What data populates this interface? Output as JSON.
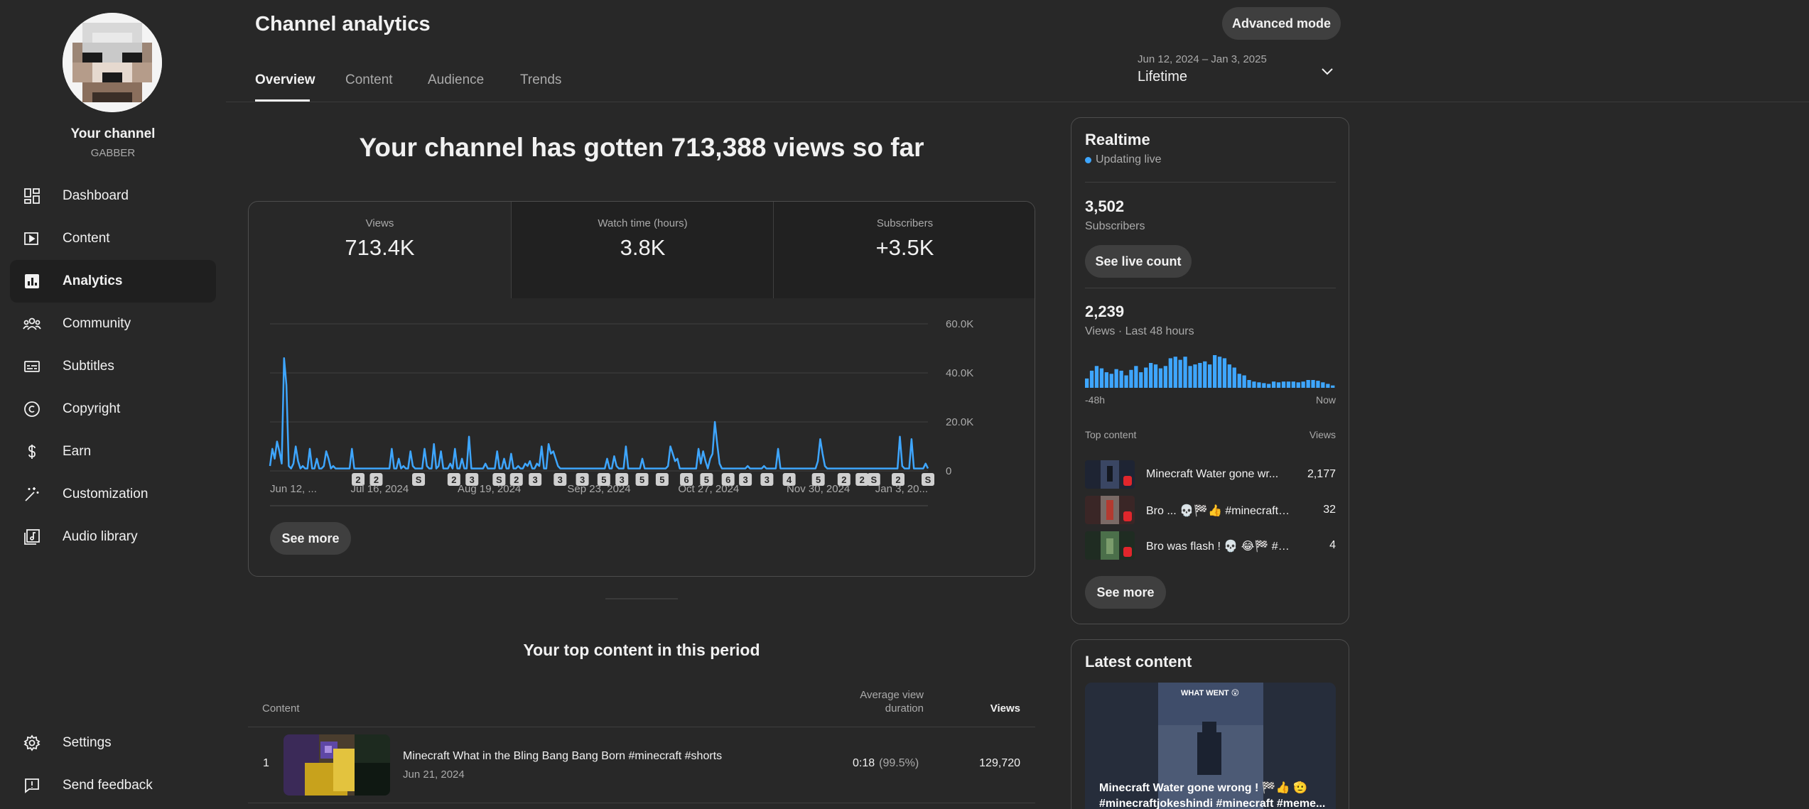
{
  "sidebar": {
    "channel_name": "Your channel",
    "channel_handle": "GABBER",
    "items": [
      {
        "label": "Dashboard",
        "icon": "dashboard-icon"
      },
      {
        "label": "Content",
        "icon": "content-icon"
      },
      {
        "label": "Analytics",
        "icon": "analytics-icon",
        "active": true
      },
      {
        "label": "Community",
        "icon": "community-icon"
      },
      {
        "label": "Subtitles",
        "icon": "subtitles-icon"
      },
      {
        "label": "Copyright",
        "icon": "copyright-icon"
      },
      {
        "label": "Earn",
        "icon": "earn-icon"
      },
      {
        "label": "Customization",
        "icon": "customization-icon"
      },
      {
        "label": "Audio library",
        "icon": "audio-library-icon"
      }
    ],
    "bottom_items": [
      {
        "label": "Settings",
        "icon": "gear-icon"
      },
      {
        "label": "Send feedback",
        "icon": "feedback-icon"
      }
    ]
  },
  "header": {
    "title": "Channel analytics",
    "advanced_mode": "Advanced mode",
    "tabs": [
      "Overview",
      "Content",
      "Audience",
      "Trends"
    ],
    "date_range": "Jun 12, 2024 – Jan 3, 2025",
    "date_selection": "Lifetime"
  },
  "headline": "Your channel has gotten 713,388 views so far",
  "metrics": [
    {
      "label": "Views",
      "value": "713.4K"
    },
    {
      "label": "Watch time (hours)",
      "value": "3.8K"
    },
    {
      "label": "Subscribers",
      "value": "+3.5K"
    }
  ],
  "see_more": "See more",
  "chart_data": {
    "type": "line",
    "x_tick_labels": [
      "Jun 12, ...",
      "Jul 16, 2024",
      "Aug 19, 2024",
      "Sep 23, 2024",
      "Oct 27, 2024",
      "Nov 30, 2024",
      "Jan 3, 20..."
    ],
    "y_tick_labels": [
      "60.0K",
      "40.0K",
      "20.0K",
      "0"
    ],
    "ylim": [
      0,
      60000
    ],
    "series": [
      {
        "values": [
          2000,
          9000,
          5000,
          12000,
          8000,
          3000,
          46000,
          35000,
          2000,
          1000,
          3000,
          10000,
          4000,
          1000,
          2000,
          1000,
          1000,
          9000,
          1000,
          1000,
          5000,
          1000,
          1000,
          2000,
          8000,
          5000,
          1000,
          2000,
          1000,
          1000,
          1000,
          1000,
          1000,
          1000,
          1000,
          9000,
          1000,
          1000,
          1000,
          1000,
          1000,
          1000,
          1000,
          1000,
          1000,
          1000,
          1000,
          1000,
          1000,
          1000,
          1000,
          1000,
          9000,
          1000,
          1000,
          5000,
          1000,
          2000,
          1000,
          1000,
          8000,
          2000,
          1000,
          1000,
          1000,
          1000,
          9000,
          2000,
          1000,
          1000,
          11000,
          1000,
          2000,
          8000,
          1000,
          1000,
          1000,
          3000,
          1000,
          9000,
          1000,
          1000,
          5000,
          1000,
          1000,
          14000,
          1000,
          1000,
          1000,
          1000,
          1000,
          1000,
          3000,
          1000,
          1000,
          1000,
          1000,
          8000,
          1000,
          1000,
          5000,
          1000,
          1000,
          7000,
          1000,
          1000,
          2000,
          1000,
          1000,
          3000,
          2000,
          4000,
          1000,
          1000,
          3000,
          2000,
          10000,
          1000,
          1000,
          11000,
          7000,
          8000,
          5000,
          2000,
          1000,
          1000,
          1000,
          1000,
          1000,
          1000,
          1000,
          1000,
          1000,
          1000,
          1000,
          1000,
          1000,
          1000,
          1000,
          1000,
          1000,
          1000,
          1000,
          1000,
          5000,
          1000,
          1000,
          6000,
          2000,
          1000,
          1000,
          1000,
          10000,
          1000,
          1000,
          1000,
          1000,
          1000,
          1000,
          5000,
          1000,
          1000,
          1000,
          1000,
          1000,
          1000,
          1000,
          1000,
          1000,
          1000,
          2000,
          10000,
          7000,
          4000,
          5000,
          1000,
          1000,
          1000,
          1000,
          1000,
          1000,
          1000,
          1000,
          9000,
          3000,
          8000,
          4000,
          1000,
          5000,
          7000,
          20000,
          11000,
          3000,
          1000,
          1000,
          1000,
          1000,
          1000,
          1000,
          1000,
          1000,
          1000,
          1000,
          1000,
          2000,
          1000,
          1000,
          1000,
          1000,
          1000,
          1000,
          2000,
          1000,
          1000,
          1000,
          1000,
          1000,
          9000,
          1000,
          1000,
          1000,
          1000,
          1000,
          1000,
          1000,
          1000,
          1000,
          1000,
          1000,
          1000,
          1000,
          1000,
          1000,
          1000,
          4000,
          13000,
          7000,
          2000,
          1000,
          1000,
          1000,
          1000,
          1000,
          1000,
          1000,
          1000,
          1000,
          1000,
          1000,
          1000,
          1000,
          1000,
          1000,
          1000,
          1000,
          1000,
          1000,
          1000,
          1000,
          1000,
          1000,
          1000,
          1000,
          1000,
          1000,
          1000,
          1000,
          1000,
          1000,
          14000,
          2000,
          1000,
          1000,
          1000,
          13000,
          1000,
          1000,
          1000,
          1000,
          1000,
          3000,
          1000
        ]
      }
    ],
    "markers": [
      "2",
      "2",
      "shorts",
      "2",
      "3",
      "shorts",
      "2",
      "3",
      "3",
      "3",
      "5",
      "3",
      "5",
      "5",
      "6",
      "5",
      "6",
      "3",
      "3",
      "4",
      "5",
      "2",
      "2",
      "shorts",
      "2",
      "shorts"
    ],
    "grid": true
  },
  "top_content": {
    "title": "Your top content in this period",
    "columns": {
      "content": "Content",
      "avg_duration_1": "Average view",
      "avg_duration_2": "duration",
      "views": "Views"
    },
    "rows": [
      {
        "rank": "1",
        "name": "Minecraft What in the Bling Bang Bang Born #minecraft #shorts",
        "date": "Jun 21, 2024",
        "duration": "0:18",
        "pct": "(99.5%)",
        "views": "129,720"
      }
    ]
  },
  "realtime": {
    "title": "Realtime",
    "updating": "Updating live",
    "subscribers_value": "3,502",
    "subscribers_label": "Subscribers",
    "see_live_count": "See live count",
    "views_value": "2,239",
    "views_label": "Views · Last 48 hours",
    "bars": [
      12,
      22,
      28,
      25,
      20,
      18,
      24,
      22,
      16,
      23,
      28,
      20,
      26,
      32,
      30,
      25,
      28,
      38,
      40,
      36,
      40,
      28,
      30,
      32,
      34,
      30,
      42,
      40,
      38,
      30,
      26,
      18,
      16,
      10,
      8,
      7,
      6,
      5,
      8,
      7,
      8,
      8,
      8,
      7,
      8,
      10,
      10,
      9,
      7,
      5,
      3
    ],
    "axis_left": "-48h",
    "axis_right": "Now",
    "top_content_label": "Top content",
    "views_col_label": "Views",
    "rows": [
      {
        "name": "Minecraft Water gone wr...",
        "views": "2,177"
      },
      {
        "name": "Bro ... 💀🏁👍 #minecraft #...",
        "views": "32"
      },
      {
        "name": "Bro was flash ! 💀 😂🏁 #min...",
        "views": "4"
      }
    ]
  },
  "latest_content": {
    "title": "Latest content",
    "thumb_text": "WHAT WENT 😲",
    "caption": "Minecraft Water gone wrong ! 🏁👍 🫡 #minecraftjokeshindi #minecraft #meme..."
  },
  "colors": {
    "background": "#282828",
    "accent_line": "#3ea6ff",
    "text": "#f1f1f1",
    "muted": "#aaaaaa"
  }
}
